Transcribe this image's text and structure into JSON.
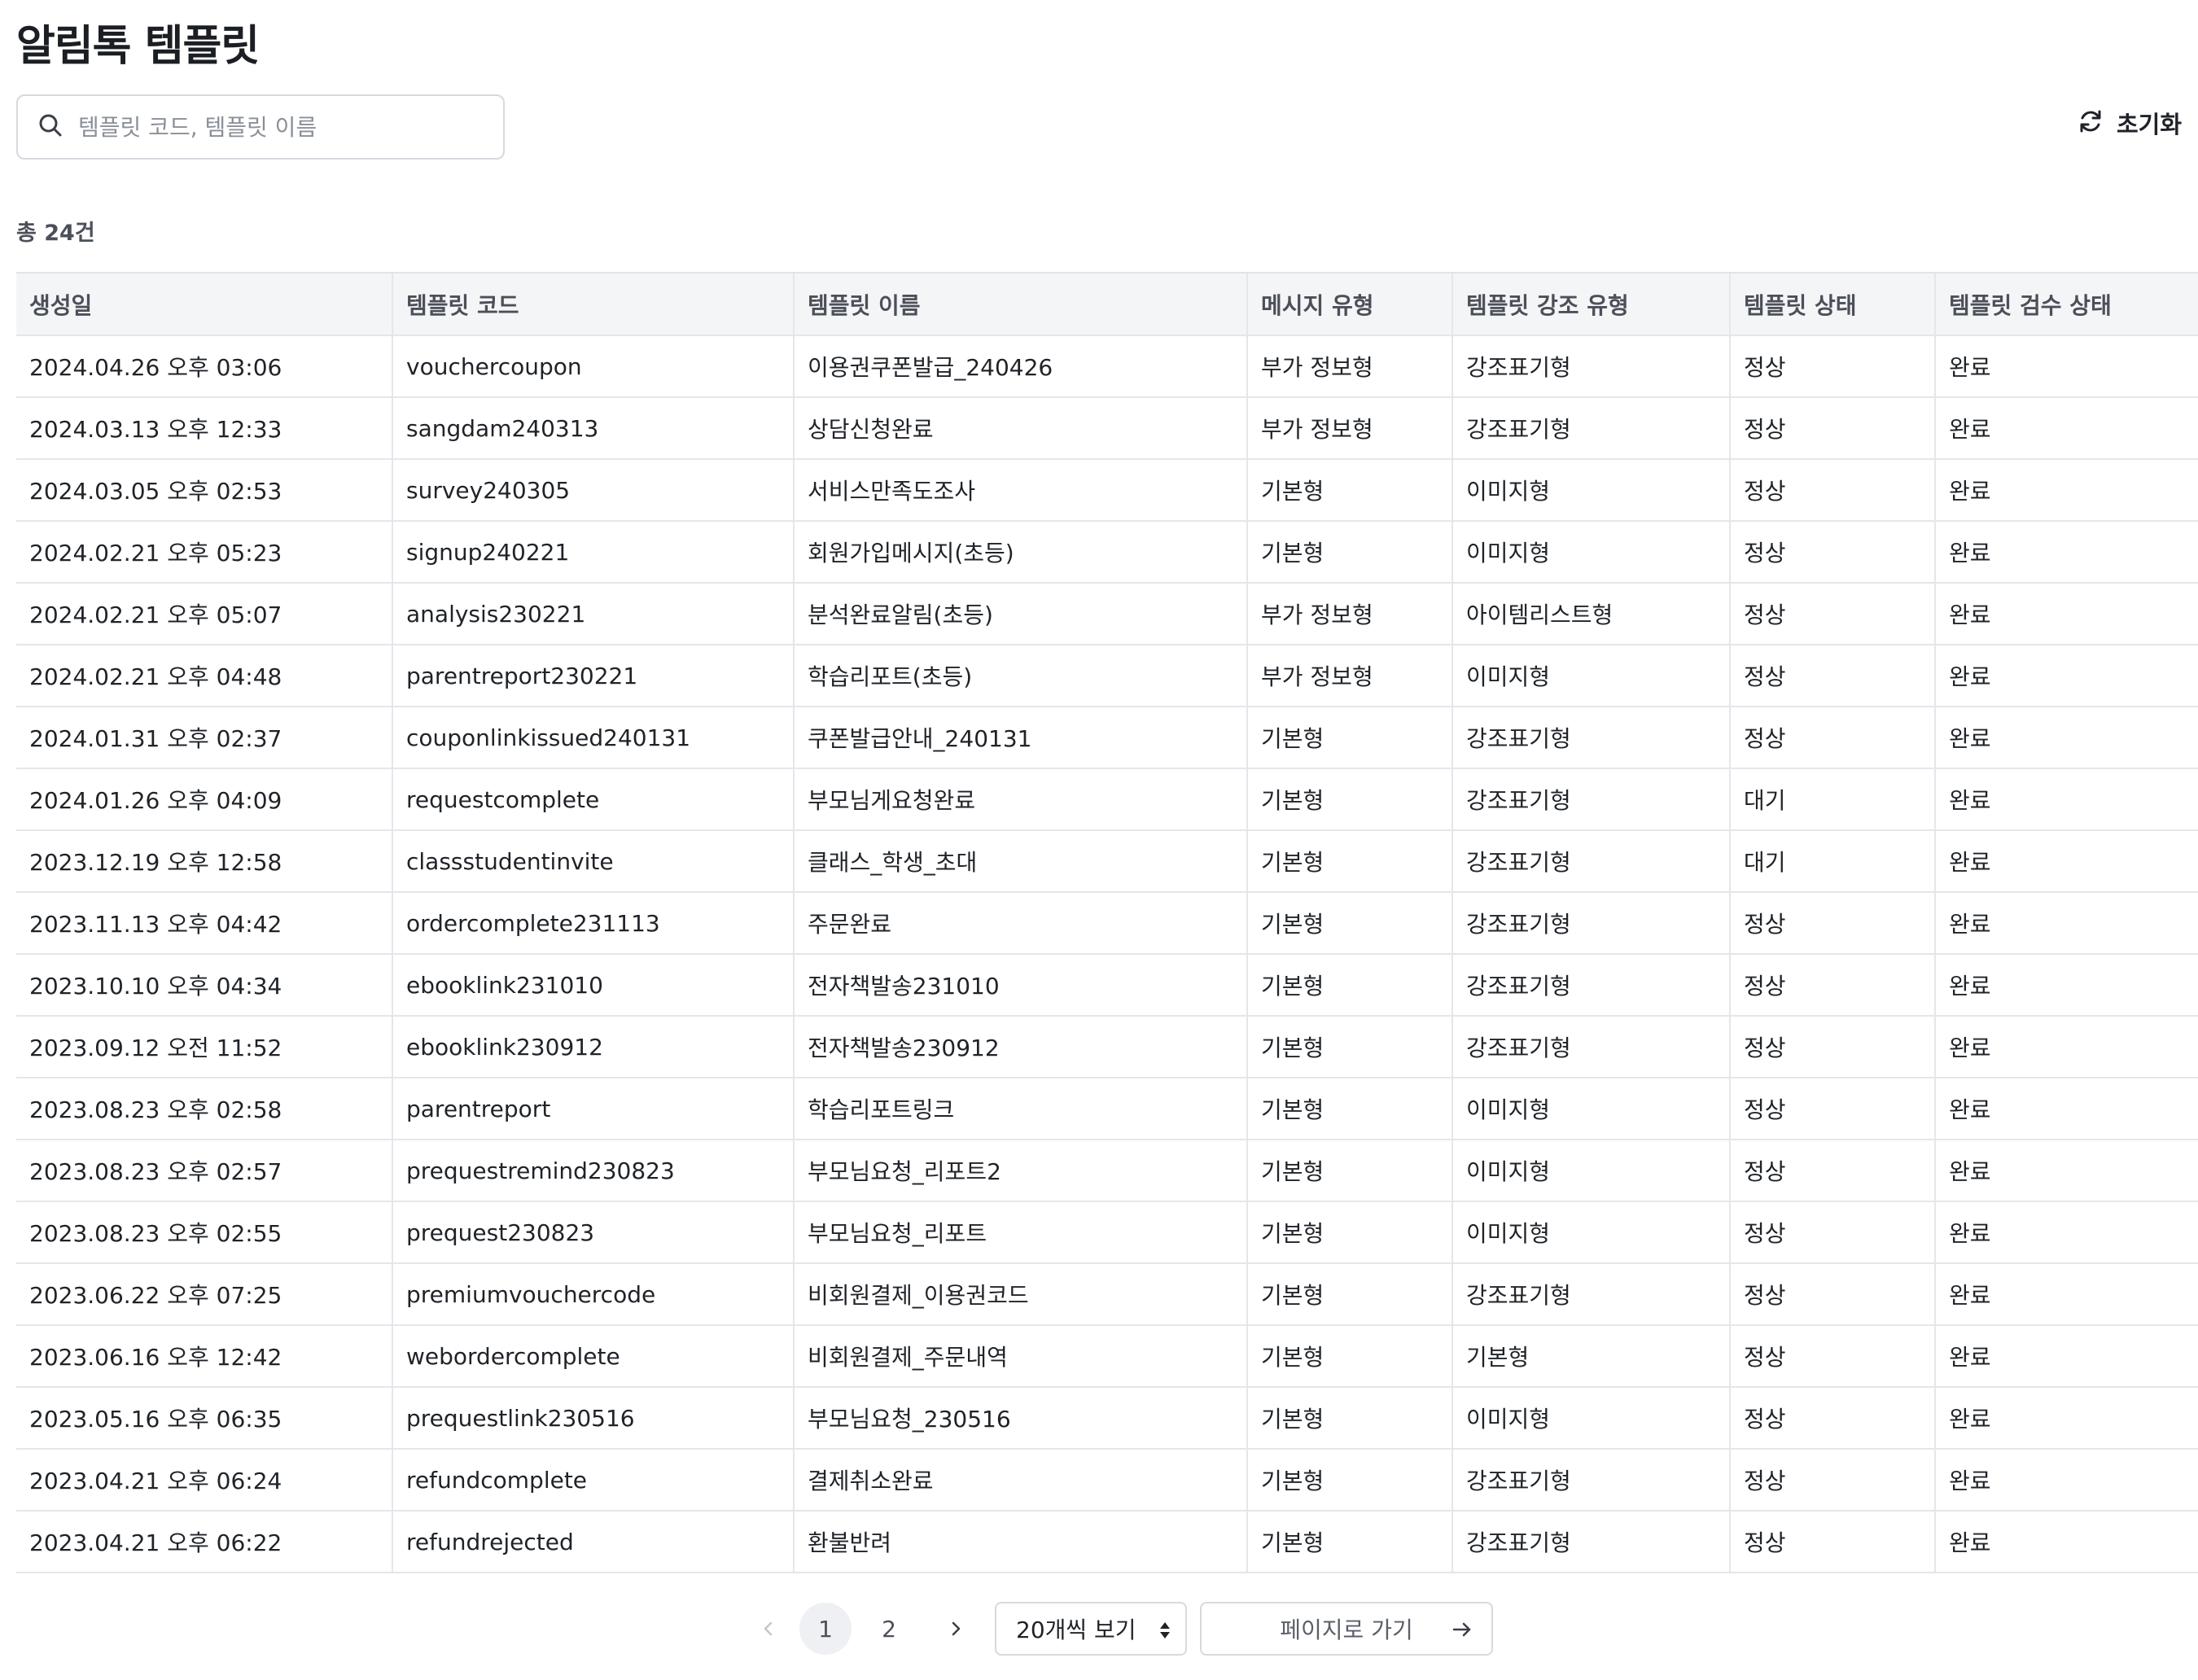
{
  "page_title": "알림톡 템플릿",
  "search": {
    "placeholder": "템플릿 코드, 템플릿 이름",
    "value": ""
  },
  "reset_label": "초기화",
  "total_label": "총 24건",
  "table": {
    "headers": [
      "생성일",
      "템플릿 코드",
      "템플릿 이름",
      "메시지 유형",
      "템플릿 강조 유형",
      "템플릿 상태",
      "템플릿 검수 상태"
    ],
    "rows": [
      [
        "2024.04.26 오후 03:06",
        "vouchercoupon",
        "이용권쿠폰발급_240426",
        "부가 정보형",
        "강조표기형",
        "정상",
        "완료"
      ],
      [
        "2024.03.13 오후 12:33",
        "sangdam240313",
        "상담신청완료",
        "부가 정보형",
        "강조표기형",
        "정상",
        "완료"
      ],
      [
        "2024.03.05 오후 02:53",
        "survey240305",
        "서비스만족도조사",
        "기본형",
        "이미지형",
        "정상",
        "완료"
      ],
      [
        "2024.02.21 오후 05:23",
        "signup240221",
        "회원가입메시지(초등)",
        "기본형",
        "이미지형",
        "정상",
        "완료"
      ],
      [
        "2024.02.21 오후 05:07",
        "analysis230221",
        "분석완료알림(초등)",
        "부가 정보형",
        "아이템리스트형",
        "정상",
        "완료"
      ],
      [
        "2024.02.21 오후 04:48",
        "parentreport230221",
        "학습리포트(초등)",
        "부가 정보형",
        "이미지형",
        "정상",
        "완료"
      ],
      [
        "2024.01.31 오후 02:37",
        "couponlinkissued240131",
        "쿠폰발급안내_240131",
        "기본형",
        "강조표기형",
        "정상",
        "완료"
      ],
      [
        "2024.01.26 오후 04:09",
        "requestcomplete",
        "부모님게요청완료",
        "기본형",
        "강조표기형",
        "대기",
        "완료"
      ],
      [
        "2023.12.19 오후 12:58",
        "classstudentinvite",
        "클래스_학생_초대",
        "기본형",
        "강조표기형",
        "대기",
        "완료"
      ],
      [
        "2023.11.13 오후 04:42",
        "ordercomplete231113",
        "주문완료",
        "기본형",
        "강조표기형",
        "정상",
        "완료"
      ],
      [
        "2023.10.10 오후 04:34",
        "ebooklink231010",
        "전자책발송231010",
        "기본형",
        "강조표기형",
        "정상",
        "완료"
      ],
      [
        "2023.09.12 오전 11:52",
        "ebooklink230912",
        "전자책발송230912",
        "기본형",
        "강조표기형",
        "정상",
        "완료"
      ],
      [
        "2023.08.23 오후 02:58",
        "parentreport",
        "학습리포트링크",
        "기본형",
        "이미지형",
        "정상",
        "완료"
      ],
      [
        "2023.08.23 오후 02:57",
        "prequestremind230823",
        "부모님요청_리포트2",
        "기본형",
        "이미지형",
        "정상",
        "완료"
      ],
      [
        "2023.08.23 오후 02:55",
        "prequest230823",
        "부모님요청_리포트",
        "기본형",
        "이미지형",
        "정상",
        "완료"
      ],
      [
        "2023.06.22 오후 07:25",
        "premiumvouchercode",
        "비회원결제_이용권코드",
        "기본형",
        "강조표기형",
        "정상",
        "완료"
      ],
      [
        "2023.06.16 오후 12:42",
        "webordercomplete",
        "비회원결제_주문내역",
        "기본형",
        "기본형",
        "정상",
        "완료"
      ],
      [
        "2023.05.16 오후 06:35",
        "prequestlink230516",
        "부모님요청_230516",
        "기본형",
        "이미지형",
        "정상",
        "완료"
      ],
      [
        "2023.04.21 오후 06:24",
        "refundcomplete",
        "결제취소완료",
        "기본형",
        "강조표기형",
        "정상",
        "완료"
      ],
      [
        "2023.04.21 오후 06:22",
        "refundrejected",
        "환불반려",
        "기본형",
        "강조표기형",
        "정상",
        "완료"
      ]
    ]
  },
  "pagination": {
    "pages": [
      "1",
      "2"
    ],
    "current_page": "1",
    "page_size_label": "20개씩 보기",
    "goto_placeholder": "페이지로 가기"
  },
  "icons": {
    "search": "search-icon",
    "reset": "refresh-icon",
    "prev": "chevron-left-icon",
    "next": "chevron-right-icon",
    "sort": "sort-icon",
    "go": "arrow-right-icon"
  }
}
